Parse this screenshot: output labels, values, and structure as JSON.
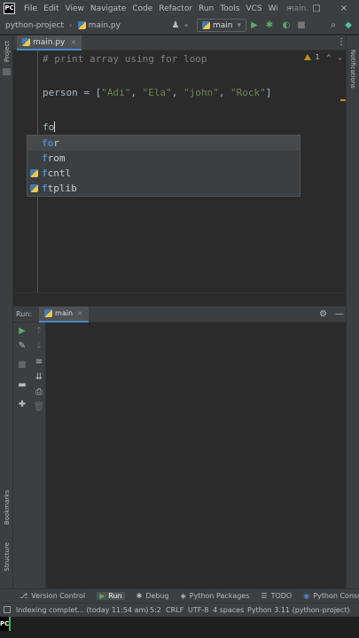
{
  "app": {
    "logo_text": "PC",
    "menu": [
      "File",
      "Edit",
      "View",
      "Navigate",
      "Code",
      "Refactor",
      "Run",
      "Tools",
      "VCS",
      "Wi"
    ],
    "title_snippet": "main.",
    "window_buttons": [
      "–",
      "□",
      "×"
    ]
  },
  "navbar": {
    "project": "python-project",
    "file": "main.py",
    "run_config": "main",
    "run_config_arrow": "▾",
    "icons": [
      "user-icon",
      "run-icon",
      "debug-icon",
      "coverage-icon",
      "stop-icon",
      "search-icon",
      "settings-logo-icon"
    ]
  },
  "tabs": [
    {
      "label": "main.py",
      "close": "×"
    }
  ],
  "editor": {
    "lines": {
      "comment": "# print array using for loop",
      "assign_prefix": "person = [",
      "str1": "\"Adi\"",
      "str2": "\"Ela\"",
      "str3": "\"john\"",
      "str4": "\"Rock\"",
      "sep": ", ",
      "close": "]",
      "typed": "fo"
    },
    "inspection_count": "1",
    "nav_up": "⌃",
    "nav_down": "⌄"
  },
  "completion": {
    "items": [
      {
        "match": "fo",
        "rest": "r"
      },
      {
        "match": "f",
        "rest": "rom"
      },
      {
        "match": "f",
        "rest": "cntl"
      },
      {
        "match": "f",
        "rest": "tplib"
      }
    ]
  },
  "run_window": {
    "label": "Run:",
    "tab": "main",
    "tab_close": "×"
  },
  "strips": {
    "project": "Project",
    "notifications": "Notifications",
    "bookmarks": "Bookmarks",
    "structure": "Structure"
  },
  "bottom_bar": {
    "items": [
      {
        "label": "Version Control",
        "icon": "version-control-icon",
        "glyph": "⎇"
      },
      {
        "label": "Run",
        "icon": "run-icon",
        "glyph": "▶"
      },
      {
        "label": "Debug",
        "icon": "debug-icon",
        "glyph": "✱"
      },
      {
        "label": "Python Packages",
        "icon": "packages-icon",
        "glyph": "◈"
      },
      {
        "label": "TODO",
        "icon": "todo-icon",
        "glyph": "☰"
      },
      {
        "label": "Python Console",
        "icon": "console-icon",
        "glyph": "◉"
      }
    ]
  },
  "status_bar": {
    "message": "Indexing complet... (today 11:54 am)",
    "position": "5:2",
    "line_sep": "CRLF",
    "encoding": "UTF-8",
    "indent": "4 spaces",
    "interpreter": "Python 3.11 (python-project)"
  },
  "colors": {
    "accent": "#4a88c7",
    "run_green": "#59a869",
    "string_green": "#6a8759",
    "warning": "#be9117"
  }
}
